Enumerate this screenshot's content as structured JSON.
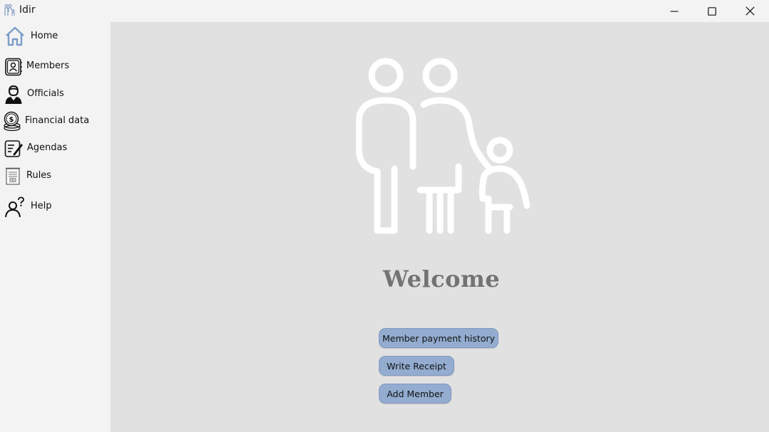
{
  "window": {
    "title": "Idir"
  },
  "sidebar": {
    "items": [
      {
        "label": "Home",
        "icon": "home-icon"
      },
      {
        "label": "Members",
        "icon": "members-book-icon"
      },
      {
        "label": "Officials",
        "icon": "official-person-icon"
      },
      {
        "label": "Financial data",
        "icon": "coins-icon"
      },
      {
        "label": "Agendas",
        "icon": "agenda-notepad-icon"
      },
      {
        "label": "Rules",
        "icon": "rules-document-icon"
      },
      {
        "label": "Help",
        "icon": "help-person-icon"
      }
    ]
  },
  "main": {
    "hero_icon": "family-icon",
    "welcome": "Welcome",
    "buttons": {
      "payment_history": "Member payment history",
      "write_receipt": "Write Receipt",
      "add_member": "Add Member"
    }
  },
  "colors": {
    "sidebar_bg": "#f3f3f3",
    "main_bg": "#e1e1e1",
    "button_bg": "#93acd0",
    "welcome_text": "#737373",
    "home_icon": "#7a9cc8"
  }
}
